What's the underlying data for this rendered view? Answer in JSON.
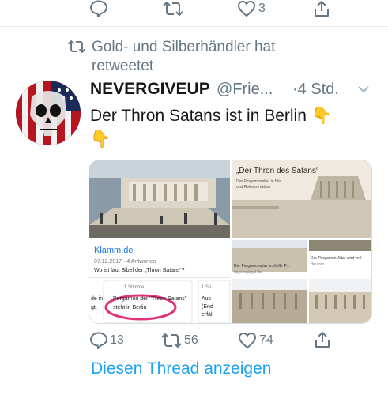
{
  "top_actions": {
    "like_count": "3"
  },
  "retweet_banner": {
    "text": "Gold- und Silberhändler hat retweetet"
  },
  "tweet": {
    "display_name": "NEVERGIVEUP",
    "handle": "@Frie...",
    "time": "·4 Std.",
    "text": "Der Thron Satans ist in Berlin",
    "emoji_1": "👇",
    "emoji_2": "👇",
    "reply_count": "13",
    "retweet_count": "56",
    "like_count": "74"
  },
  "media": {
    "right_top_title": "„Der Thron des Satans“",
    "right_top_sub": "Der Pergamonaltar in Bild und Rekonstruktion",
    "klamm_source": "Klamm.de",
    "klamm_meta": "07.12.2017 · 4 Antworten",
    "klamm_question": "Wo ist laut Bibel der „Thron Satans“?",
    "vote_label": "1 Stimme",
    "vote_label_2": "1 Sti",
    "answer_text_1": "Pergamon der \"Thron Satans\"",
    "answer_text_2": "steht in Berlin",
    "left_snippet_1": "de in",
    "left_snippet_2": "gt,",
    "right_snippet_1": "Aus",
    "right_snippet_2": "(End",
    "right_snippet_3": "erfäl",
    "mid_caption": "Der Pergamonaltar schließt: P...",
    "mid_source": "tagesspiegel.de",
    "right_caption": "Der Pergamon-Altar wird verl",
    "right_source": "dw.com"
  },
  "show_thread": "Diesen Thread anzeigen",
  "colors": {
    "accent": "#1da1f2",
    "muted": "#657786",
    "text": "#14171a",
    "pink": "#e0337a"
  },
  "icons": [
    "reply-icon",
    "retweet-icon",
    "like-icon",
    "share-icon",
    "caret-down-icon"
  ]
}
